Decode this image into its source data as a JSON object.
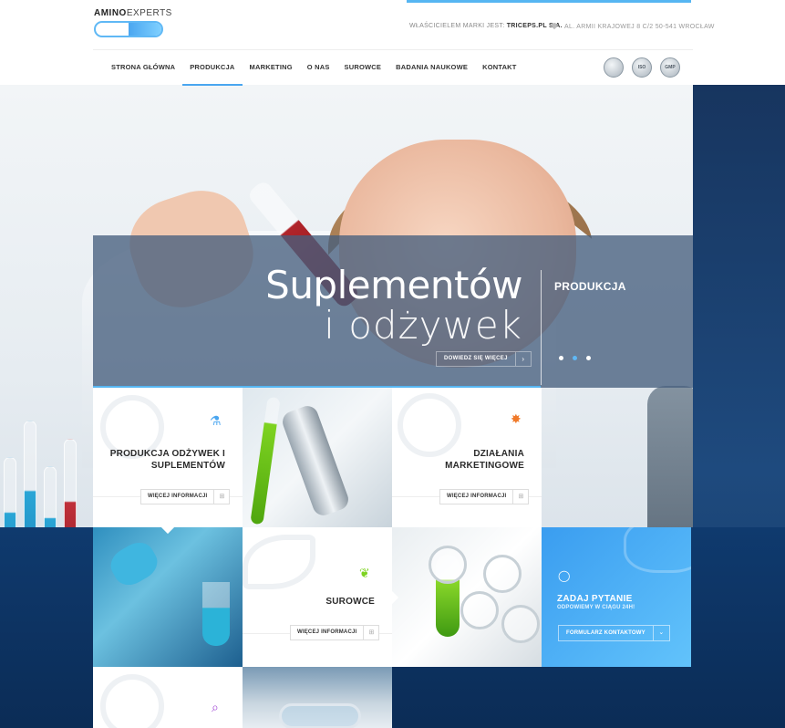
{
  "brand": {
    "logo_bold": "AMINO",
    "logo_thin": "EXPERTS"
  },
  "header": {
    "owner_label": "WŁAŚCICIELEM MARKI JEST:",
    "owner_value": "TRICEPS.PL S.A.",
    "address": "AL. ARMII KRAJOWEJ 8 C/2 50-541 WROCŁAW"
  },
  "nav": {
    "items": [
      {
        "label": "STRONA GŁÓWNA"
      },
      {
        "label": "PRODUKCJA"
      },
      {
        "label": "MARKETING"
      },
      {
        "label": "O NAS"
      },
      {
        "label": "SUROWCE"
      },
      {
        "label": "BADANIA NAUKOWE"
      },
      {
        "label": "KONTAKT"
      }
    ],
    "active": "PRODUKCJA",
    "badges": [
      "",
      "ISO",
      "GMP"
    ]
  },
  "slider": {
    "title_line1": "Suplementów",
    "title_line2": "i odżywek",
    "button_label": "DOWIEDZ SIĘ WIĘCEJ",
    "category": "PRODUKCJA",
    "current_slide": 2,
    "slide_count": 3
  },
  "tiles": {
    "production": {
      "title_line1": "PRODUKCJA ODŻYWEK I",
      "title_line2": "SUPLEMENTÓW",
      "button_label": "WIĘCEJ INFORMACJI"
    },
    "marketing": {
      "title_line1": "DZIAŁANIA",
      "title_line2": "MARKETINGOWE",
      "button_label": "WIĘCEJ INFORMACJI"
    },
    "materials": {
      "title": "SUROWCE",
      "button_label": "WIĘCEJ INFORMACJI"
    },
    "contact": {
      "title": "ZADAJ PYTANIE",
      "subtitle": "ODPOWIEMY W CIĄGU 24H!",
      "button_label": "FORMULARZ KONTAKTOWY"
    }
  },
  "colors": {
    "accent": "#4aa6f0",
    "contact_gradient": [
      "#3a9df0",
      "#62c3fb"
    ],
    "dark_panel": "#17355f"
  },
  "icons": {
    "production": "flask-icon",
    "marketing": "bulb-icon",
    "materials": "leaf-icon",
    "research": "magnifier-icon",
    "contact": "speech-bubble-icon",
    "address": "map-pin-icon"
  }
}
